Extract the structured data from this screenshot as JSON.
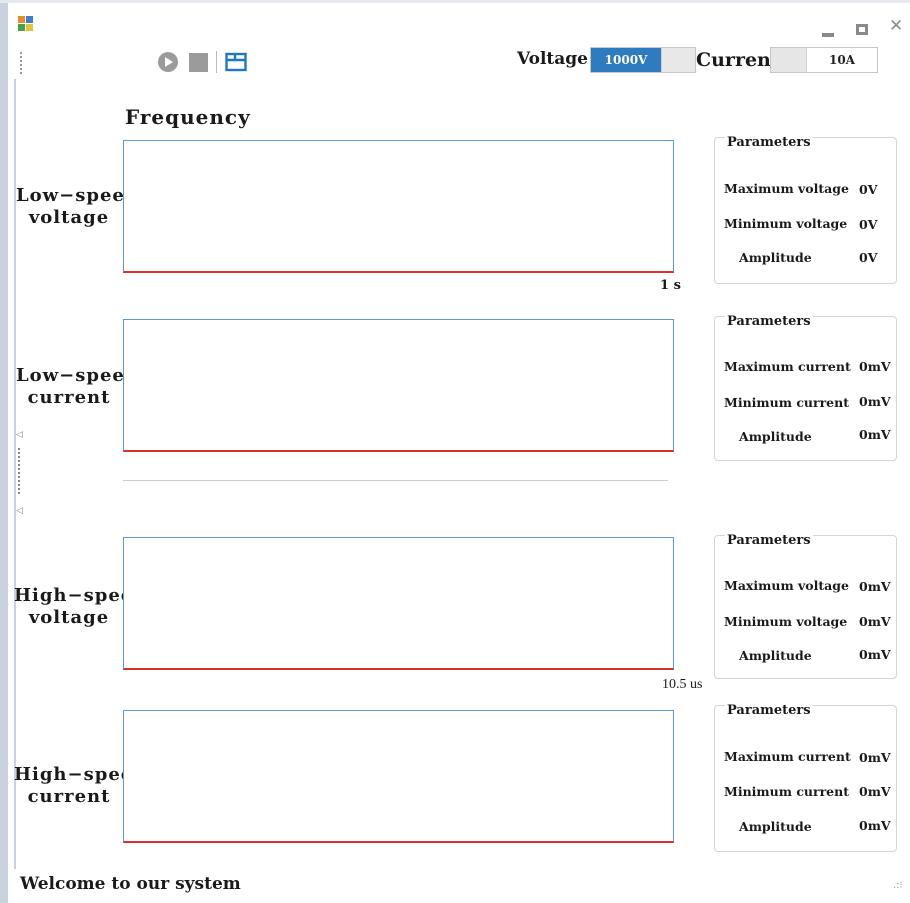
{
  "toolbar": {
    "voltage_label": "Voltage",
    "voltage_value": "1000V",
    "current_label": "Current",
    "current_value": "10A",
    "icons": [
      "play-icon",
      "stop-icon",
      "folder-icon"
    ]
  },
  "window": {
    "controls": [
      "minimize",
      "maximize",
      "close"
    ]
  },
  "main": {
    "frequency_title": "Frequency",
    "low_speed_time_label": "1 s",
    "high_speed_time_label": "10.5 us"
  },
  "plots": [
    {
      "label_line1": "Low−speed",
      "label_line2": "voltage",
      "params_title": "Parameters",
      "p1_name": "Maximum voltage",
      "p1_value": "0V",
      "p2_name": "Minimum voltage",
      "p2_value": "0V",
      "p3_name": "Amplitude",
      "p3_value": "0V"
    },
    {
      "label_line1": "Low−speed",
      "label_line2": "current",
      "params_title": "Parameters",
      "p1_name": "Maximum current",
      "p1_value": "0mV",
      "p2_name": "Minimum current",
      "p2_value": "0mV",
      "p3_name": "Amplitude",
      "p3_value": "0mV"
    },
    {
      "label_line1": "High−speed",
      "label_line2": "voltage",
      "params_title": "Parameters",
      "p1_name": "Maximum voltage",
      "p1_value": "0mV",
      "p2_name": "Minimum voltage",
      "p2_value": "0mV",
      "p3_name": "Amplitude",
      "p3_value": "0mV"
    },
    {
      "label_line1": "High−speed",
      "label_line2": "current",
      "params_title": "Parameters",
      "p1_name": "Maximum current",
      "p1_value": "0mV",
      "p2_name": "Minimum current",
      "p2_value": "0mV",
      "p3_name": "Amplitude",
      "p3_value": "0mV"
    }
  ],
  "status": {
    "message": "Welcome to our system"
  },
  "colors": {
    "accent": "#2f7bbf",
    "plot_border": "#5b9bd5",
    "plot_baseline": "#d9302b"
  }
}
